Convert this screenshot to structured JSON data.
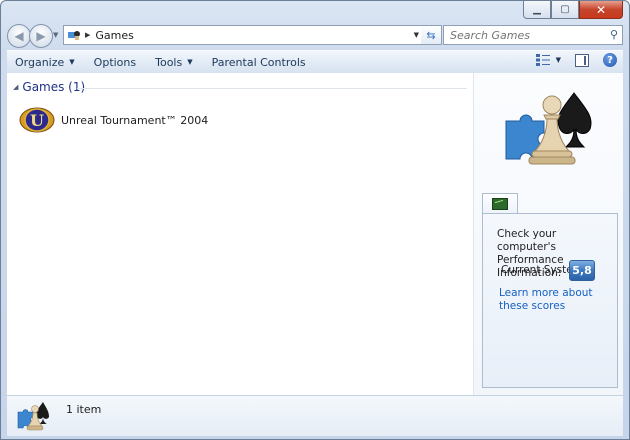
{
  "window": {
    "caption_buttons": [
      "minimize",
      "maximize",
      "close"
    ]
  },
  "address_bar": {
    "path": "Games",
    "search_placeholder": "Search Games"
  },
  "toolbar": {
    "items": [
      {
        "label": "Organize",
        "has_dropdown": true
      },
      {
        "label": "Options",
        "has_dropdown": false
      },
      {
        "label": "Tools",
        "has_dropdown": true
      },
      {
        "label": "Parental Controls",
        "has_dropdown": false
      }
    ]
  },
  "group": {
    "title": "Games (1)"
  },
  "games": [
    {
      "name": "Unreal Tournament™ 2004",
      "icon": "unreal-tournament-icon"
    }
  ],
  "performance": {
    "heading": "Check your computer's Performance Information:",
    "label": "Current System",
    "score": "5,8",
    "link": "Learn more about these scores"
  },
  "status": {
    "item_count": "1 item"
  },
  "colors": {
    "accent": "#1e3287",
    "link": "#1560c4",
    "score_badge": "#3d78c1"
  }
}
